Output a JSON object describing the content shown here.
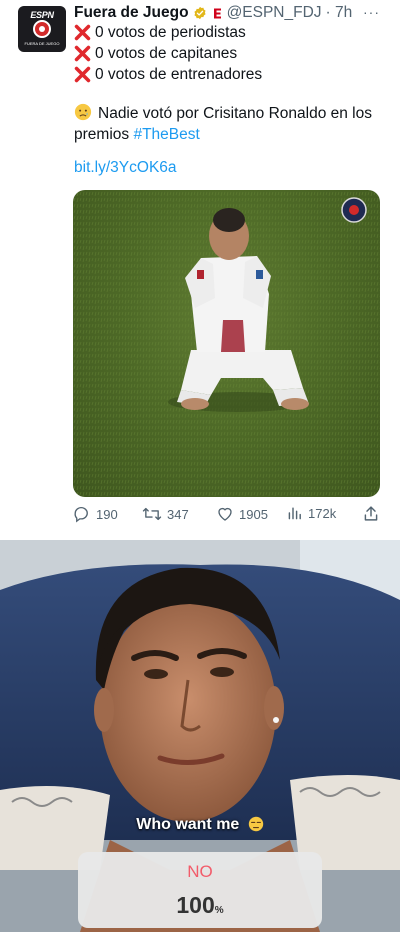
{
  "tweet": {
    "author_name": "Fuera de Juego",
    "handle": "@ESPN_FDJ",
    "time": "· 7h",
    "avatar_brand": "ESPN",
    "avatar_subtitle": "FUERA DE JUEGO",
    "more_label": "···",
    "lines": [
      "0 votos de periodistas",
      "0 votos de capitanes",
      "0 votos de entrenadores"
    ],
    "message": "Nadie votó por Crisitano Ronaldo en los premios",
    "hashtag": "#TheBest",
    "link": "bit.ly/3YcOK6a",
    "actions": {
      "replies": "190",
      "retweets": "347",
      "likes": "1905",
      "views": "172k"
    },
    "colors": {
      "accent": "#1d9bf0",
      "muted": "#536471",
      "verified": "#e2b719",
      "x_mark": "#e0282d"
    }
  },
  "story": {
    "caption": "Who want me",
    "poll_option": "NO",
    "poll_percent": "100",
    "poll_unit": "%",
    "poll_share": 1.0,
    "colors": {
      "poll_option": "#f25c6a"
    }
  }
}
